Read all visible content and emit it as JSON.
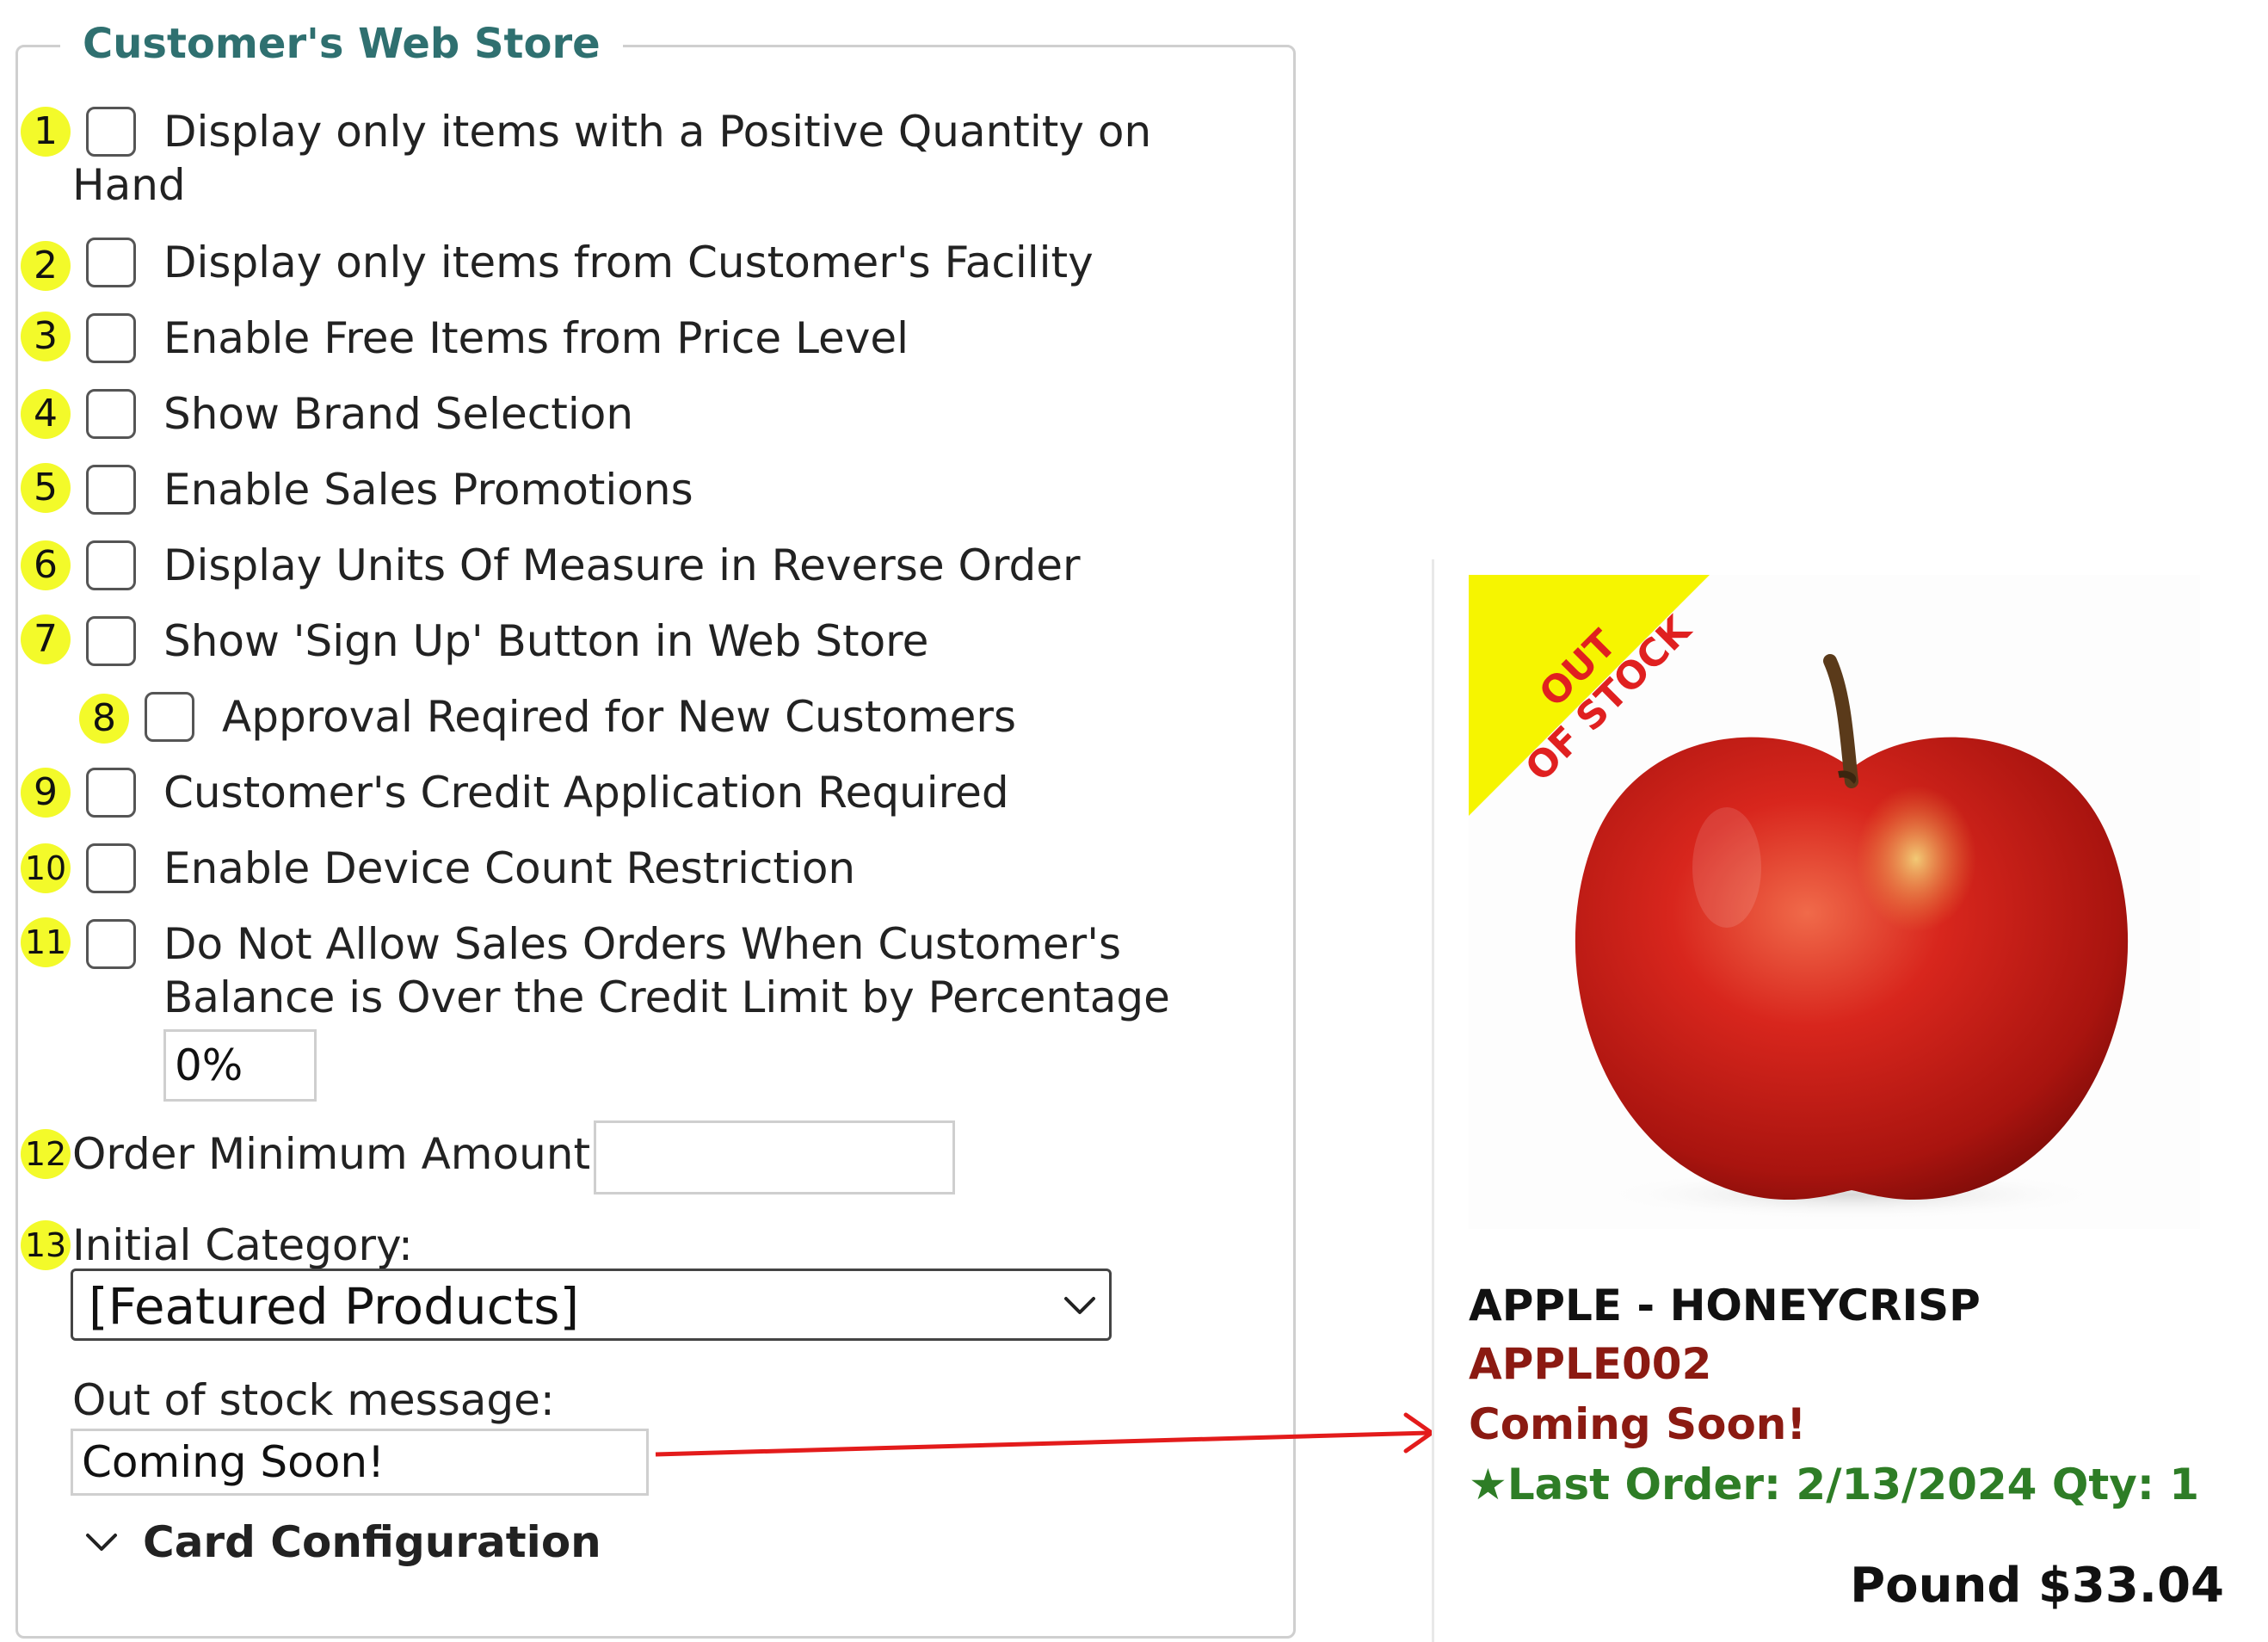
{
  "settings": {
    "legend": "Customer's Web Store",
    "items": [
      {
        "number": "1",
        "label_line1": "Display only items with a Positive Quantity on",
        "label_line2": "Hand",
        "checked": false
      },
      {
        "number": "2",
        "label": "Display only items from Customer's Facility",
        "checked": false
      },
      {
        "number": "3",
        "label": "Enable Free Items from Price Level",
        "checked": false
      },
      {
        "number": "4",
        "label": "Show Brand Selection",
        "checked": false
      },
      {
        "number": "5",
        "label": "Enable Sales Promotions",
        "checked": false
      },
      {
        "number": "6",
        "label": "Display Units Of Measure in Reverse Order",
        "checked": false
      },
      {
        "number": "7",
        "label": "Show 'Sign Up' Button in Web Store",
        "checked": false
      },
      {
        "number": "8",
        "label": "Approval Reqired for New Customers",
        "checked": false
      },
      {
        "number": "9",
        "label": "Customer's Credit Application Required",
        "checked": false
      },
      {
        "number": "10",
        "label": "Enable Device Count Restriction",
        "checked": false
      },
      {
        "number": "11",
        "label_line1": "Do Not Allow Sales Orders When Customer's",
        "label_line2": "Balance is Over the Credit Limit by Percentage",
        "checked": false,
        "percentage_value": "0%"
      }
    ],
    "order_minimum": {
      "number": "12",
      "label": "Order Minimum Amount:",
      "value": ""
    },
    "initial_category": {
      "number": "13",
      "label": "Initial Category:",
      "selected": "[Featured Products]"
    },
    "out_of_stock": {
      "label": "Out of stock message:",
      "value": "Coming Soon!"
    },
    "card_configuration": {
      "label": "Card Configuration",
      "icon": "chevron-down-icon"
    }
  },
  "product_card": {
    "ribbon": {
      "line1": "OUT",
      "line2": "OF STOCK"
    },
    "name": "APPLE - HONEYCRISP",
    "sku": "APPLE002",
    "stock_message": "Coming Soon!",
    "last_order": "★Last Order: 2/13/2024 Qty: 1",
    "price": "Pound $33.04",
    "image": "red-apple-photo"
  },
  "colors": {
    "legend": "#2f7070",
    "badge": "#f3fa2a",
    "ribbon": "#f6f500",
    "ribbon_text": "#e02020",
    "sku_red": "#8b1a12",
    "last_order_green": "#2e7d26",
    "arrow": "#e31b1b"
  }
}
